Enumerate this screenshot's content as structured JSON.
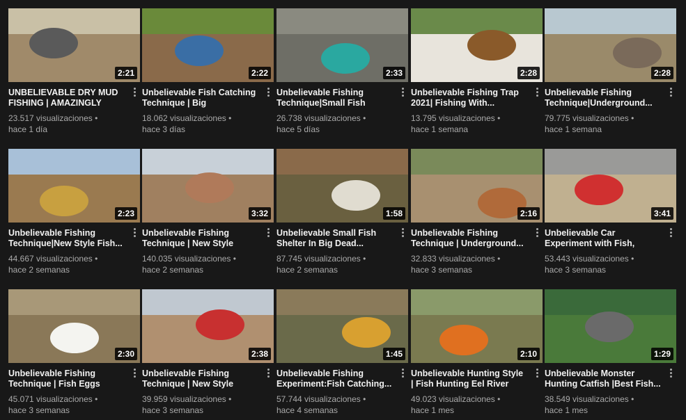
{
  "videos": [
    {
      "title": "UNBELIEVABLE DRY MUD FISHING | AMAZINGLY FISH...",
      "views": "23.517 visualizaciones •",
      "age": "hace 1 día",
      "duration": "2:21",
      "sky": "#c9c0a6",
      "ground": "#a08a6a",
      "accent": "#5a5a5a"
    },
    {
      "title": "Unbelievable Fish Catching Technique | Big Snakehead...",
      "views": "18.062 visualizaciones •",
      "age": "hace 3 días",
      "duration": "2:22",
      "sky": "#6a8a3a",
      "ground": "#8a6a4a",
      "accent": "#3a6ea5"
    },
    {
      "title": "Unbelievable Fishing Technique|Small Fish Come...",
      "views": "26.738 visualizaciones •",
      "age": "hace 5 días",
      "duration": "2:33",
      "sky": "#8a8a80",
      "ground": "#6e6e66",
      "accent": "#2aa8a0"
    },
    {
      "title": "Unbelievable Fishing Trap 2021| Fishing With...",
      "views": "13.795 visualizaciones •",
      "age": "hace 1 semana",
      "duration": "2:28",
      "sky": "#6a8a4a",
      "ground": "#e8e4dc",
      "accent": "#8a5a2a"
    },
    {
      "title": "Unbelievable Fishing Technique|Underground...",
      "views": "79.775 visualizaciones •",
      "age": "hace 1 semana",
      "duration": "2:28",
      "sky": "#b8c8d0",
      "ground": "#9a8a6a",
      "accent": "#7a6a5a"
    },
    {
      "title": "Unbelievable Fishing Technique|New Style Fish...",
      "views": "44.667 visualizaciones •",
      "age": "hace 2 semanas",
      "duration": "2:23",
      "sky": "#a8c0d8",
      "ground": "#9a7a50",
      "accent": "#c8a040"
    },
    {
      "title": "Unbelievable Fishing Technique | New Style Fish...",
      "views": "140.035 visualizaciones •",
      "age": "hace 2 semanas",
      "duration": "3:32",
      "sky": "#c8d0d8",
      "ground": "#a08060",
      "accent": "#b07a5a"
    },
    {
      "title": "Unbelievable Small Fish Shelter In Big Dead...",
      "views": "87.745 visualizaciones •",
      "age": "hace 2 semanas",
      "duration": "1:58",
      "sky": "#8a6a4a",
      "ground": "#6a6040",
      "accent": "#e0dcd0"
    },
    {
      "title": "Unbelievable Fishing Technique | Underground...",
      "views": "32.833 visualizaciones •",
      "age": "hace 3 semanas",
      "duration": "2:16",
      "sky": "#7a8a5a",
      "ground": "#a89070",
      "accent": "#b06a3a"
    },
    {
      "title": "Unbelievable Car Experiment with Fish, Coca-Cola-...",
      "views": "53.443 visualizaciones •",
      "age": "hace 3 semanas",
      "duration": "3:41",
      "sky": "#9a9a98",
      "ground": "#c0b090",
      "accent": "#d03030"
    },
    {
      "title": "Unbelievable Fishing Technique | Fish Eggs Com...",
      "views": "45.071 visualizaciones •",
      "age": "hace 3 semanas",
      "duration": "2:30",
      "sky": "#a89878",
      "ground": "#8a7858",
      "accent": "#f4f4f0"
    },
    {
      "title": "Unbelievable Fishing Technique | New Style Fish...",
      "views": "39.959 visualizaciones •",
      "age": "hace 3 semanas",
      "duration": "2:38",
      "sky": "#c0c8d0",
      "ground": "#b09070",
      "accent": "#c83030"
    },
    {
      "title": "Unbelievable Fishing Experiment:Fish Catching...",
      "views": "57.744 visualizaciones •",
      "age": "hace 4 semanas",
      "duration": "1:45",
      "sky": "#8a7a5a",
      "ground": "#6a6a4a",
      "accent": "#d8a030"
    },
    {
      "title": "Unbelievable Hunting Style | Fish Hunting Eel River Side...",
      "views": "49.023 visualizaciones •",
      "age": "hace 1 mes",
      "duration": "2:10",
      "sky": "#8a9a6a",
      "ground": "#7a7a50",
      "accent": "#e07020"
    },
    {
      "title": "Unbelievable Monster Hunting Catfish |Best Fish...",
      "views": "38.549 visualizaciones •",
      "age": "hace 1 mes",
      "duration": "1:29",
      "sky": "#3a6a3a",
      "ground": "#4a7a3a",
      "accent": "#6a6a6a"
    }
  ]
}
